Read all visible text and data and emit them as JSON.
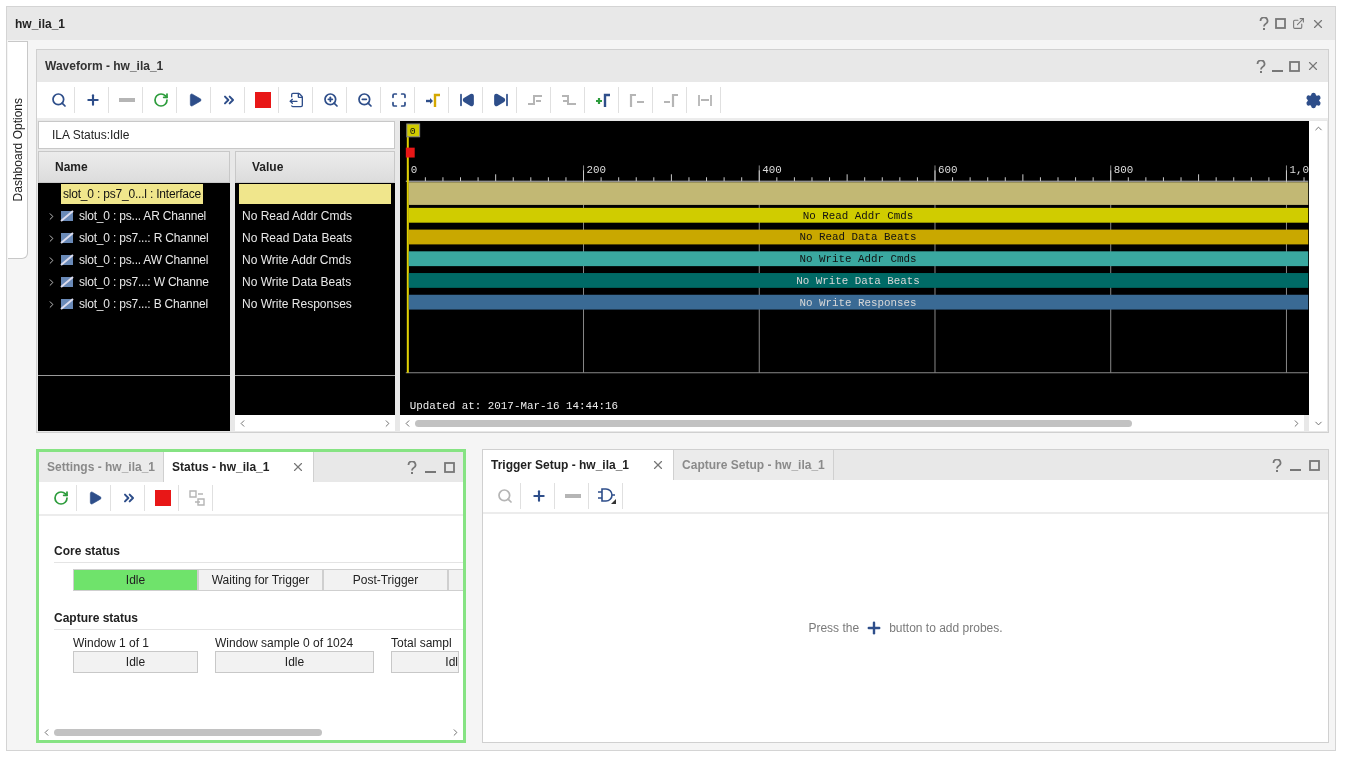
{
  "window": {
    "title": "hw_ila_1"
  },
  "side_tab": {
    "label": "Dashboard Options"
  },
  "waveform": {
    "title": "Waveform - hw_ila_1",
    "toolbar": [
      {
        "kind": "search",
        "disabled": false
      },
      {
        "kind": "add",
        "disabled": false
      },
      {
        "kind": "remove",
        "disabled": true
      },
      {
        "kind": "run-immediate",
        "disabled": false
      },
      {
        "kind": "run",
        "disabled": false
      },
      {
        "kind": "run-auto",
        "disabled": false
      },
      {
        "kind": "stop",
        "disabled": false
      },
      {
        "kind": "export",
        "disabled": false
      },
      {
        "kind": "zoom-in",
        "disabled": false
      },
      {
        "kind": "zoom-out",
        "disabled": false
      },
      {
        "kind": "zoom-fit",
        "disabled": false
      },
      {
        "kind": "go-cursor",
        "disabled": false
      },
      {
        "kind": "go-start",
        "disabled": false
      },
      {
        "kind": "go-end",
        "disabled": false
      },
      {
        "kind": "prev-transition",
        "disabled": true
      },
      {
        "kind": "next-transition",
        "disabled": true
      },
      {
        "kind": "add-marker",
        "disabled": false
      },
      {
        "kind": "prev-marker",
        "disabled": true
      },
      {
        "kind": "next-marker",
        "disabled": true
      },
      {
        "kind": "marker-span",
        "disabled": true
      }
    ],
    "ila_status": "ILA Status:Idle",
    "columns": [
      "Name",
      "Value"
    ],
    "rows": [
      {
        "kind": "interface",
        "name": "slot_0 : ps7_0...l : Interface",
        "selected": true
      },
      {
        "kind": "channel",
        "name": "slot_0 : ps... AR Channel",
        "value": "No Read Addr Cmds",
        "selected": false,
        "expanded": false
      },
      {
        "kind": "channel",
        "name": "slot_0 : ps7...: R Channel",
        "value": "No Read Data Beats",
        "selected": false,
        "expanded": false
      },
      {
        "kind": "channel",
        "name": "slot_0 : ps... AW Channel",
        "value": "No Write Addr Cmds",
        "selected": false,
        "expanded": false
      },
      {
        "kind": "channel",
        "name": "slot_0 : ps7...: W Channe",
        "value": "No Write Data Beats",
        "selected": false,
        "expanded": false
      },
      {
        "kind": "channel",
        "name": "slot_0 : ps7...: B Channel",
        "value": "No Write Responses",
        "selected": false,
        "expanded": false
      }
    ],
    "cursor_label": "0",
    "ruler": [
      "0",
      "200",
      "400",
      "600",
      "800",
      "1,0"
    ],
    "waves": [
      {
        "color": "#c2b874"
      },
      {
        "color": "#d0cc00",
        "label": "No Read Addr Cmds"
      },
      {
        "color": "#c9a800",
        "label": "No Read Data Beats"
      },
      {
        "color": "#3aa8a0",
        "label": "No Write Addr Cmds"
      },
      {
        "color": "#006a66",
        "label": "No Write Data Beats"
      },
      {
        "color": "#3a6a94",
        "label": "No Write Responses"
      }
    ],
    "updated": "Updated at: 2017-Mar-16 14:44:16"
  },
  "status_panel": {
    "tabs": [
      {
        "label": "Settings - hw_ila_1",
        "selected": false
      },
      {
        "label": "Status - hw_ila_1",
        "selected": true
      }
    ],
    "toolbar": [
      {
        "kind": "run-immediate",
        "disabled": false
      },
      {
        "kind": "run",
        "disabled": false
      },
      {
        "kind": "run-auto",
        "disabled": false
      },
      {
        "kind": "stop",
        "disabled": false
      },
      {
        "kind": "swap",
        "disabled": true
      }
    ],
    "core_heading": "Core status",
    "core_states": [
      {
        "label": "Idle",
        "selected": true
      },
      {
        "label": "Waiting for Trigger",
        "selected": false
      },
      {
        "label": "Post-Trigger",
        "selected": false
      }
    ],
    "capture_heading": "Capture status",
    "capture": [
      {
        "label": "Window 1 of 1",
        "value": "Idle"
      },
      {
        "label": "Window sample 0 of 1024",
        "value": "Idle"
      },
      {
        "label": "Total sampl",
        "value": "Idl"
      }
    ]
  },
  "trigger_panel": {
    "tabs": [
      {
        "label": "Trigger Setup - hw_ila_1",
        "selected": true
      },
      {
        "label": "Capture Setup - hw_ila_1",
        "selected": false
      }
    ],
    "toolbar": [
      {
        "kind": "search",
        "disabled": true
      },
      {
        "kind": "add",
        "disabled": false
      },
      {
        "kind": "remove",
        "disabled": true
      },
      {
        "kind": "gate",
        "disabled": false
      }
    ],
    "message_before": "Press the",
    "message_after": "button to add probes."
  }
}
